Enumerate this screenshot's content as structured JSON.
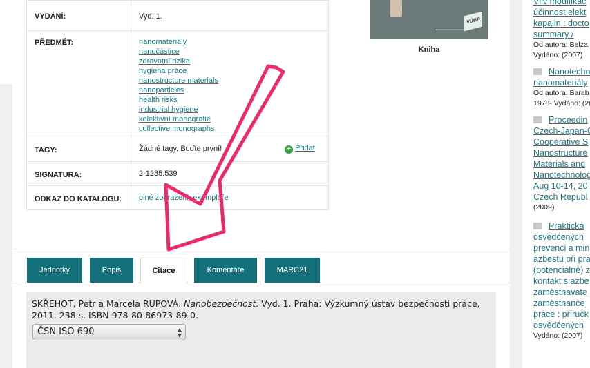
{
  "details": {
    "rows": [
      {
        "label": "VYDÁNÍ:",
        "value": "Vyd. 1."
      },
      {
        "label": "PŘEDMĚT:",
        "subjects": [
          "nanomateriály",
          "nanočástice",
          "zdravotní rizika",
          "hygiena práce",
          "nanostructure materials",
          "nanoparticles",
          "health risks",
          "industrial hygiene",
          "kolektivní monografie",
          "collective monographs"
        ]
      },
      {
        "label": "TAGY:",
        "value": "Žádné tagy, Buďte první!",
        "action": "Přidat"
      },
      {
        "label": "SIGNATURA:",
        "value": "2-1285.539"
      },
      {
        "label": "ODKAZ DO KATALOGU:",
        "links": [
          "plné zobrazení",
          "exempláře"
        ],
        "sep": ","
      }
    ]
  },
  "cover": {
    "caption": "Kniha",
    "logo": "VÚBP"
  },
  "tabs": [
    "Jednotky",
    "Popis",
    "Citace",
    "Komentáře",
    "MARC21"
  ],
  "active_tab": "Citace",
  "citation": {
    "authors": "SKŘEHOT, Petr a Marcela RUPOVÁ.",
    "title": "Nanobezpečnost",
    "rest": ". Vyd. 1. Praha: Výzkumný ústav bezpečnosti práce, 2011, 238 s. ISBN 978-80-86973-89-0.",
    "style_selected": "ČSN ISO 690"
  },
  "sidebar": {
    "top_item": {
      "lines": [
        "Vliv modifikac",
        "účinnost elekt",
        "kapalin : docto",
        "summary /"
      ],
      "author": "Od autora: Belza,",
      "published": "Vydáno: (2007)"
    },
    "items": [
      {
        "lines": [
          "Nanotechn",
          "nanomateriály"
        ],
        "author": "Od autora: Barab",
        "published": "1978- Vydáno: (2("
      },
      {
        "lines": [
          "Proceedin",
          "Czech-Japan-C",
          "Cooperative S",
          "Nanostructure",
          "Materials and",
          "Nanotechnolog",
          "Aug 10-14, 20",
          "Czech Republ"
        ],
        "published": "(2009)"
      },
      {
        "lines": [
          "Praktická",
          "osvědčených",
          "prevenci a min",
          "azbestu při pra",
          "(potenciálně) z",
          "kontakt s azbe",
          "zaměstnavate",
          "zaměstnance",
          "práce : příručk",
          "osvědčených"
        ],
        "published": "Vydáno: (2007)"
      }
    ]
  },
  "colors": {
    "tab_bg": "#14707a",
    "link": "#1a7a8a",
    "arrow": "#ec2a6a"
  }
}
